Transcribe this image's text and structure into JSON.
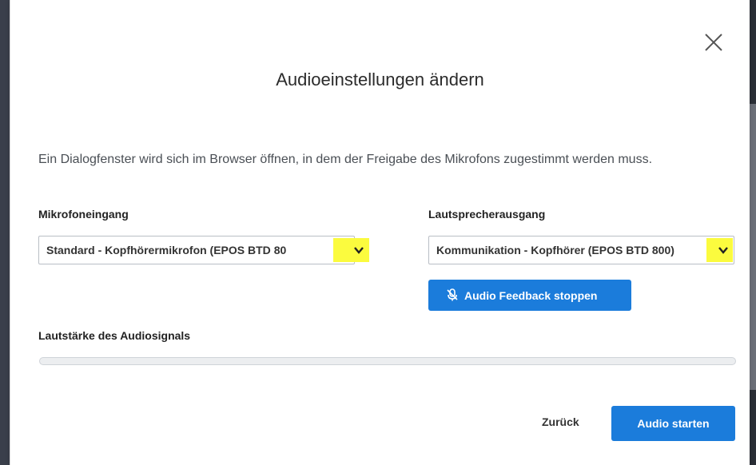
{
  "dialog": {
    "title": "Audioeinstellungen ändern",
    "info": "Ein Dialogfenster wird sich im Browser öffnen, in dem der Freigabe des Mikrofons zugestimmt werden muss."
  },
  "microphone": {
    "label": "Mikrofoneingang",
    "value_main": "Standard - Kopfhörermikrofon (EPOS BTD ",
    "value_tail": "80"
  },
  "speaker": {
    "label": "Lautsprecherausgang",
    "value_main": "Kommunikation - Kopfhörer (EPOS BTD 800",
    "value_tail": ")"
  },
  "feedback_button": {
    "label": "Audio Feedback stoppen",
    "icon": "microphone-off-icon"
  },
  "volume": {
    "label": "Lautstärke des Audiosignals",
    "level": 0
  },
  "footer": {
    "back_label": "Zurück",
    "start_label": "Audio starten"
  },
  "colors": {
    "primary": "#1b7cdb",
    "highlight": "#fbfb3e"
  }
}
